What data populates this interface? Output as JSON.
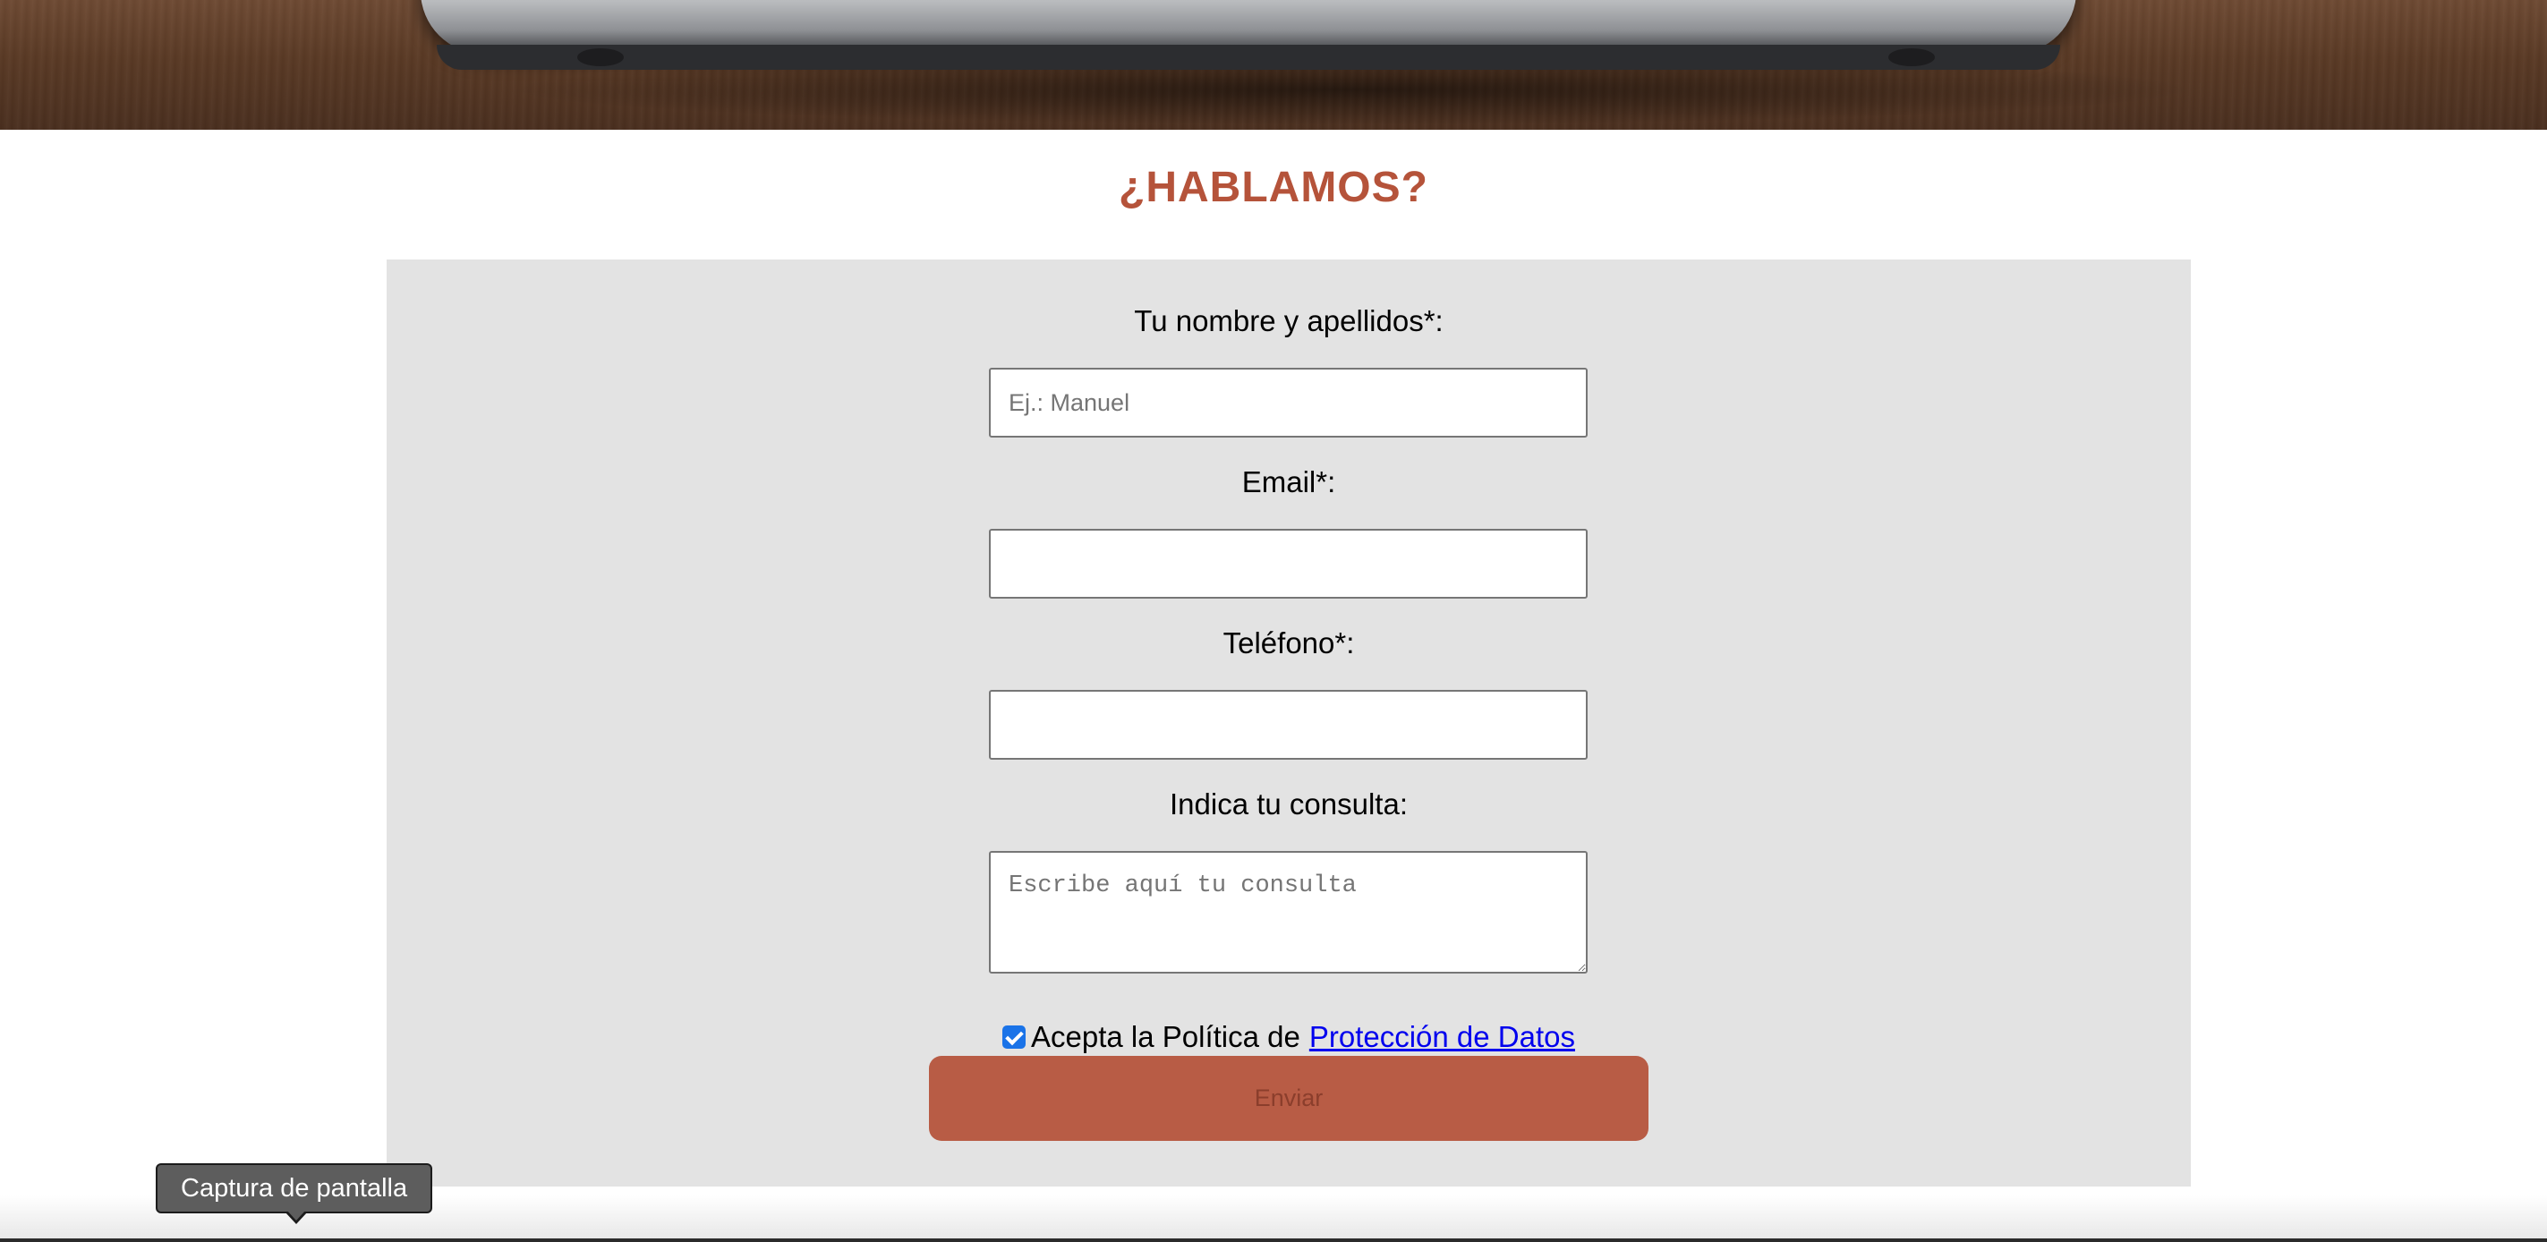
{
  "colors": {
    "accent": "#b5533a",
    "panel_bg": "#e3e3e3",
    "button_bg": "#b85c45",
    "link": "#0000ee"
  },
  "hero": {
    "image_icon": "laptop-on-desk-image"
  },
  "contact": {
    "heading": "¿HABLAMOS?",
    "name_label": "Tu nombre y apellidos*:",
    "name_placeholder": "Ej.: Manuel",
    "name_value": "",
    "email_label": "Email*:",
    "email_value": "",
    "phone_label": "Teléfono*:",
    "phone_value": "",
    "query_label": "Indica tu consulta:",
    "query_placeholder": "Escribe aquí tu consulta",
    "query_value": "",
    "consent_checked": true,
    "consent_text": "Acepta la Política de",
    "consent_link": "Protección de Datos",
    "submit_label": "Enviar"
  },
  "tooltip": {
    "text": "Captura de pantalla"
  }
}
